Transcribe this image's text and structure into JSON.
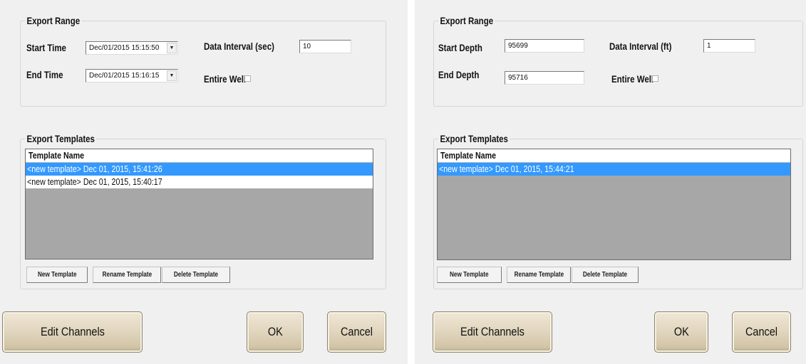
{
  "left": {
    "export_range": {
      "title": "Export Range",
      "start_label": "Start Time",
      "start_value": "Dec/01/2015 15:15:50",
      "end_label": "End Time",
      "end_value": "Dec/01/2015 15:16:15",
      "interval_label": "Data Interval (sec)",
      "interval_value": "10",
      "entire_well_label": "Entire Well"
    },
    "templates": {
      "title": "Export Templates",
      "column_header": "Template Name",
      "rows": [
        {
          "name": "<new template> Dec 01, 2015, 15:41:26",
          "selected": true
        },
        {
          "name": "<new template> Dec 01, 2015, 15:40:17",
          "selected": false
        }
      ],
      "new_button": "New Template",
      "rename_button": "Rename Template",
      "delete_button": "Delete Template"
    },
    "buttons": {
      "edit_channels": "Edit Channels",
      "ok": "OK",
      "cancel": "Cancel"
    }
  },
  "right": {
    "export_range": {
      "title": "Export Range",
      "start_label": "Start Depth",
      "start_value": "95699",
      "end_label": "End Depth",
      "end_value": "95716",
      "interval_label": "Data Interval (ft)",
      "interval_value": "1",
      "entire_well_label": "Entire Well"
    },
    "templates": {
      "title": "Export Templates",
      "column_header": "Template Name",
      "rows": [
        {
          "name": "<new template> Dec 01, 2015, 15:44:21",
          "selected": true
        }
      ],
      "new_button": "New Template",
      "rename_button": "Rename Template",
      "delete_button": "Delete Template"
    },
    "buttons": {
      "edit_channels": "Edit Channels",
      "ok": "OK",
      "cancel": "Cancel"
    }
  },
  "colors": {
    "selection": "#3399ff",
    "list_background": "#a7a7a7",
    "button_face": "#e2d7c0"
  }
}
